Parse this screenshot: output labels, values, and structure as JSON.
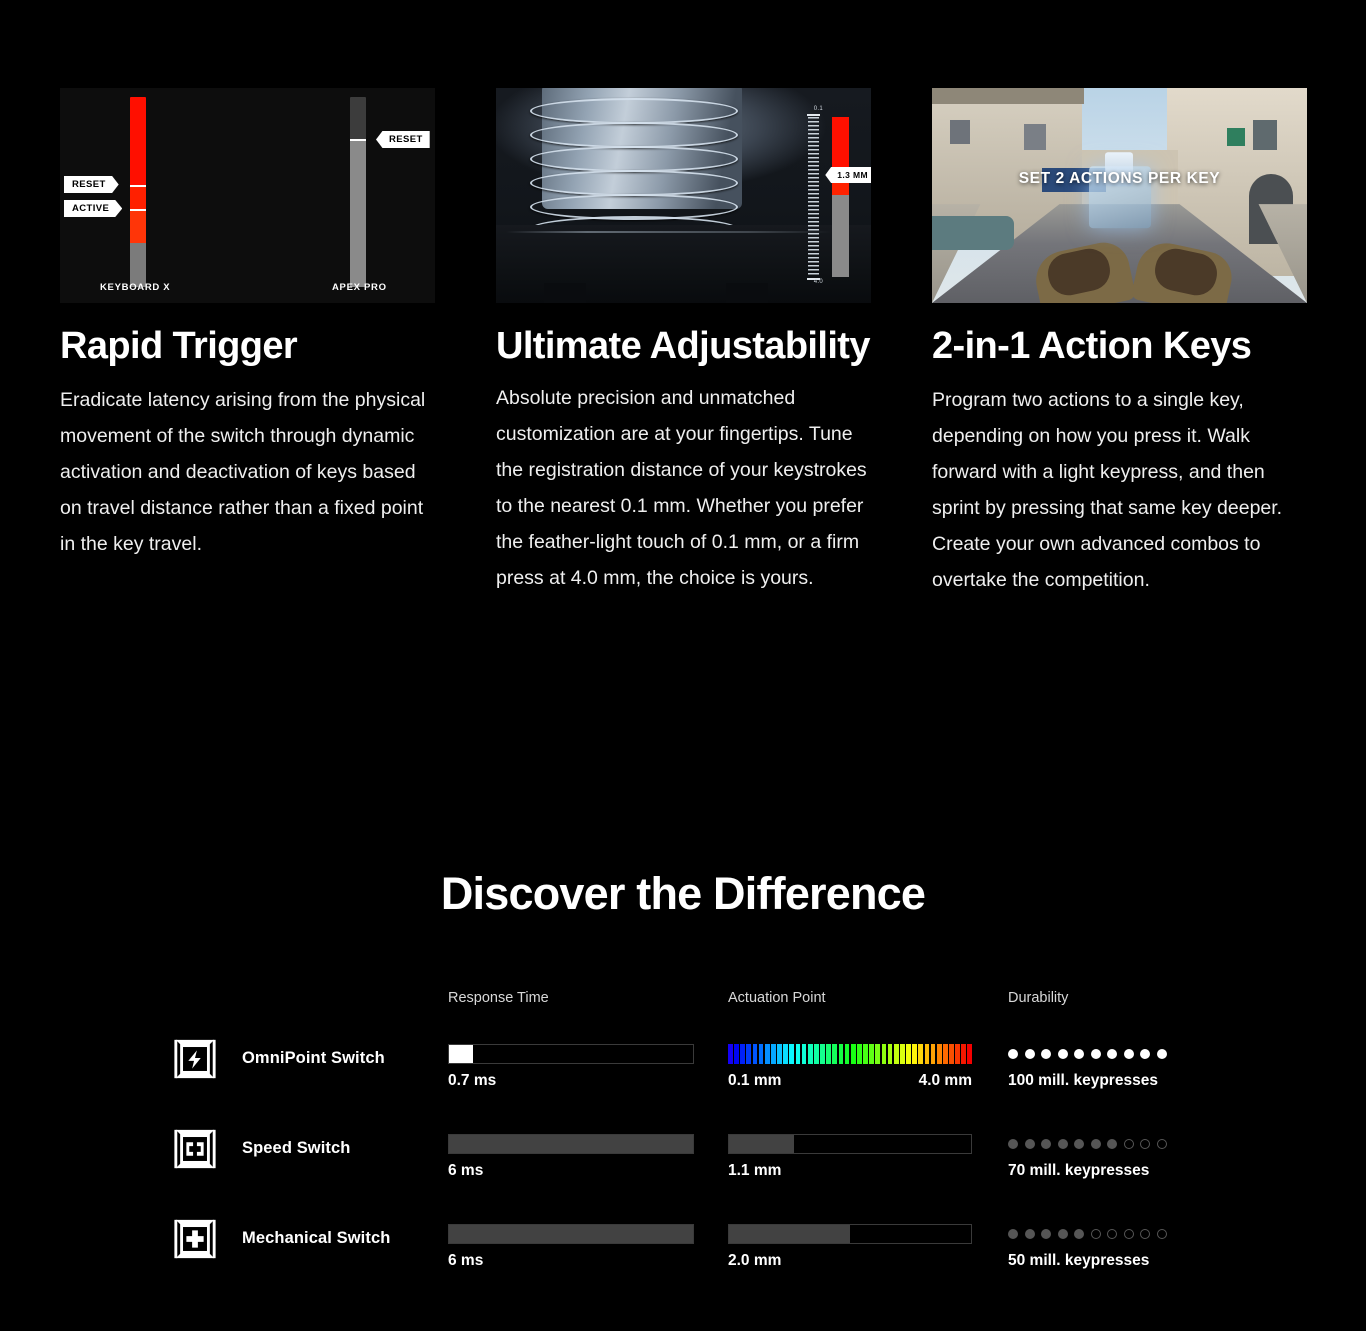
{
  "features": [
    {
      "title": "Rapid Trigger",
      "body": "Eradicate latency arising from the physical movement of the switch through dynamic activation and deactivation of keys based on travel distance rather than a fixed point in the key travel.",
      "media": {
        "kind": "rapid-trigger-diagram",
        "left_caption": "KEYBOARD X",
        "right_caption": "APEX PRO",
        "left_labels": [
          "RESET",
          "ACTIVE"
        ],
        "right_labels": [
          "RESET"
        ]
      }
    },
    {
      "title": "Ultimate Adjustability",
      "body": "Absolute precision and unmatched customization are at your fingertips. Tune the registration distance of your keystrokes to the nearest 0.1 mm. Whether you prefer the feather-light touch of 0.1 mm, or a firm press at 4.0 mm, the choice is yours.",
      "media": {
        "kind": "switch-spring-photo",
        "callout": "1.3 MM",
        "ruler_top": "0.1",
        "ruler_bottom": "4.0"
      }
    },
    {
      "title": "2-in-1 Action Keys",
      "body": "Program two actions to a single key, depending on how you press it. Walk forward with a light keypress, and then sprint by pressing that same key deeper. Create your own advanced combos to overtake the competition.",
      "media": {
        "kind": "game-screenshot",
        "overlay_text": "SET 2 ACTIONS PER KEY"
      }
    }
  ],
  "section": {
    "title": "Discover the Difference"
  },
  "chart_data": {
    "type": "table",
    "title": "Discover the Difference",
    "columns": [
      "",
      "Response Time",
      "Actuation Point",
      "Durability"
    ],
    "rows": [
      {
        "switch": "OmniPoint Switch",
        "icon": "lightning-switch-icon",
        "response_time": {
          "value": "0.7 ms",
          "fill_pct": 10,
          "style": "white"
        },
        "actuation_point": {
          "value_left": "0.1 mm",
          "value_right": "4.0 mm",
          "style": "spectrum",
          "range_mm": [
            0.1,
            4.0
          ]
        },
        "durability": {
          "value": "100 mill. keypresses",
          "filled": 10,
          "total": 10,
          "style": "white"
        }
      },
      {
        "switch": "Speed Switch",
        "icon": "contacts-switch-icon",
        "response_time": {
          "value": "6 ms",
          "fill_pct": 100,
          "style": "gray"
        },
        "actuation_point": {
          "value_left": "1.1 mm",
          "value_right": "",
          "style": "gray",
          "fill_pct": 27
        },
        "durability": {
          "value": "70 mill. keypresses",
          "filled": 7,
          "total": 10,
          "style": "gray"
        }
      },
      {
        "switch": "Mechanical Switch",
        "icon": "plus-switch-icon",
        "response_time": {
          "value": "6 ms",
          "fill_pct": 100,
          "style": "gray"
        },
        "actuation_point": {
          "value_left": "2.0 mm",
          "value_right": "",
          "style": "gray",
          "fill_pct": 50
        },
        "durability": {
          "value": "50 mill. keypresses",
          "filled": 5,
          "total": 10,
          "style": "gray"
        }
      }
    ]
  },
  "colors": {
    "background": "#000000",
    "text": "#ffffff",
    "muted": "#d8d8d8",
    "bar_gray": "#424242",
    "bar_border": "#3a3a3a",
    "accent_red": "#ff1a0d",
    "dot_gray": "#565656"
  }
}
